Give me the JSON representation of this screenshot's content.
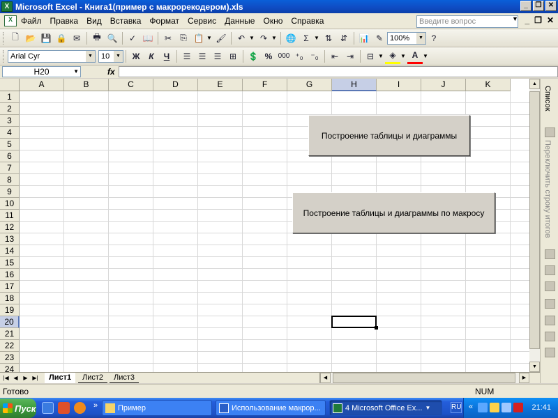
{
  "window": {
    "title": "Microsoft Excel - Книга1(пример с макрорекодером).xls",
    "app_icon": "X"
  },
  "menu": {
    "doc_icon": "excel-doc-icon",
    "items": [
      "Файл",
      "Правка",
      "Вид",
      "Вставка",
      "Формат",
      "Сервис",
      "Данные",
      "Окно",
      "Справка"
    ],
    "help_placeholder": "Введите вопрос"
  },
  "toolbar": {
    "zoom": "100%"
  },
  "format_toolbar": {
    "font_name": "Arial Cyr",
    "font_size": "10",
    "bold": "Ж",
    "italic": "К",
    "underline": "Ч",
    "percent": "%",
    "thousands": "000"
  },
  "formula_bar": {
    "cell_ref": "H20",
    "fx": "fx",
    "formula": ""
  },
  "sheet": {
    "columns": [
      "A",
      "B",
      "C",
      "D",
      "E",
      "F",
      "G",
      "H",
      "I",
      "J",
      "K"
    ],
    "rows": [
      "1",
      "2",
      "3",
      "4",
      "5",
      "6",
      "7",
      "8",
      "9",
      "10",
      "11",
      "12",
      "13",
      "14",
      "15",
      "16",
      "17",
      "18",
      "19",
      "20",
      "21",
      "22",
      "23",
      "24"
    ],
    "active_column": "H",
    "active_row": "20",
    "buttons": {
      "build_table_chart": "Построение таблицы и диаграммы",
      "build_table_chart_macro": "Построение таблицы и диаграммы по макросу"
    }
  },
  "sheet_tabs": [
    "Лист1",
    "Лист2",
    "Лист3"
  ],
  "task_pane": {
    "list_label": "Список",
    "totals_label": "Переключить строку итогов"
  },
  "status": {
    "text": "Готово",
    "num": "NUM"
  },
  "taskbar": {
    "start": "Пуск",
    "items": [
      "Пример",
      "Использование макрор...",
      "4 Microsoft Office Ex..."
    ],
    "lang": "RU",
    "clock": "21:41"
  }
}
